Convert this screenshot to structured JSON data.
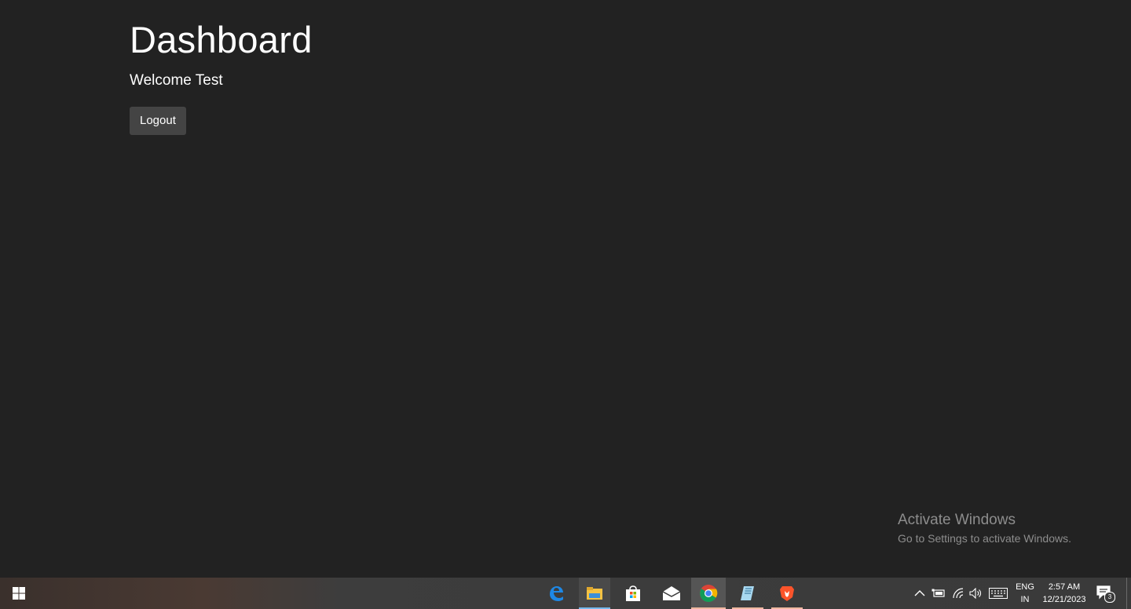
{
  "page": {
    "title": "Dashboard",
    "welcome": "Welcome Test",
    "logout_label": "Logout"
  },
  "watermark": {
    "line1": "Activate Windows",
    "line2": "Go to Settings to activate Windows."
  },
  "taskbar": {
    "apps": [
      {
        "name": "edge-icon",
        "active": false
      },
      {
        "name": "file-explorer-icon",
        "active": false
      },
      {
        "name": "store-icon",
        "active": false
      },
      {
        "name": "mail-icon",
        "active": false
      },
      {
        "name": "chrome-icon",
        "active": true
      },
      {
        "name": "notepad-icon",
        "active": false
      },
      {
        "name": "brave-icon",
        "active": false
      }
    ],
    "lang_line1": "ENG",
    "lang_line2": "IN",
    "time": "2:57 AM",
    "date": "12/21/2023",
    "notification_count": "3"
  },
  "colors": {
    "background": "#222222",
    "button": "#444444",
    "text": "#ffffff",
    "watermark": "#8d8d8d"
  }
}
